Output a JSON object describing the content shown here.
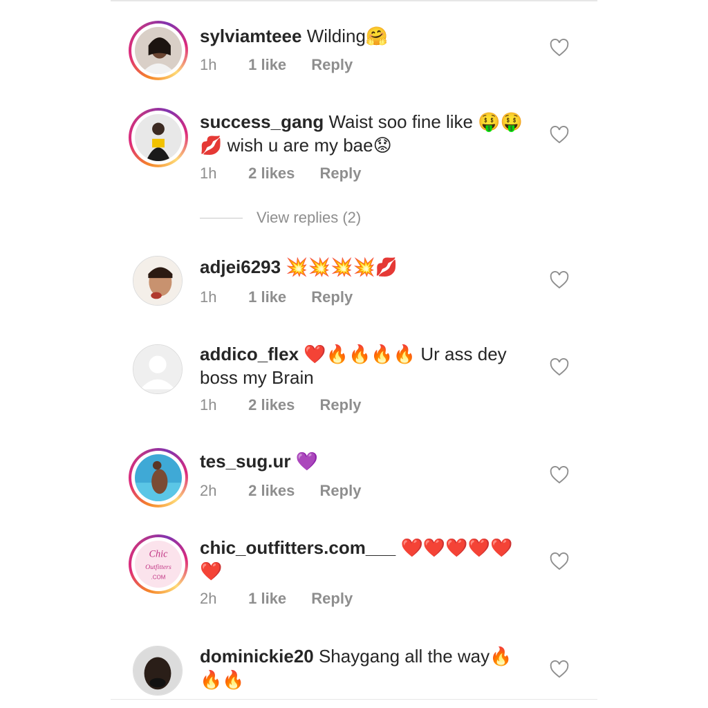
{
  "comments": [
    {
      "username": "sylviamteee",
      "text": "Wilding🤗",
      "time": "1h",
      "likes": "1 like",
      "reply": "Reply",
      "story_ring": true
    },
    {
      "username": "success_gang",
      "text": "Waist soo fine like 🤑🤑💋 wish u are my bae😟",
      "time": "1h",
      "likes": "2 likes",
      "reply": "Reply",
      "story_ring": true,
      "view_replies": "View replies (2)"
    },
    {
      "username": "adjei6293",
      "text": "💥💥💥💥💋",
      "time": "1h",
      "likes": "1 like",
      "reply": "Reply",
      "story_ring": false
    },
    {
      "username": "addico_flex",
      "text": "❤️🔥🔥🔥🔥 Ur ass dey boss my Brain",
      "time": "1h",
      "likes": "2 likes",
      "reply": "Reply",
      "story_ring": false
    },
    {
      "username": "tes_sug.ur",
      "text": "💜",
      "time": "2h",
      "likes": "2 likes",
      "reply": "Reply",
      "story_ring": true
    },
    {
      "username": "chic_outfitters.com___",
      "text": "❤️❤️❤️❤️❤️❤️",
      "time": "2h",
      "likes": "1 like",
      "reply": "Reply",
      "story_ring": true,
      "avatar_logo_text": "Chic Outfitters .COM"
    },
    {
      "username": "dominickie20",
      "text": "Shaygang all the way🔥🔥🔥",
      "time": "",
      "likes": "",
      "reply": "",
      "story_ring": false
    }
  ],
  "icons": {
    "like": "heart-outline-icon",
    "default_avatar": "user-silhouette-icon"
  },
  "colors": {
    "text": "#262626",
    "muted": "#8e8e8e",
    "story_ring_start": "#f58529",
    "story_ring_end": "#c13584"
  }
}
